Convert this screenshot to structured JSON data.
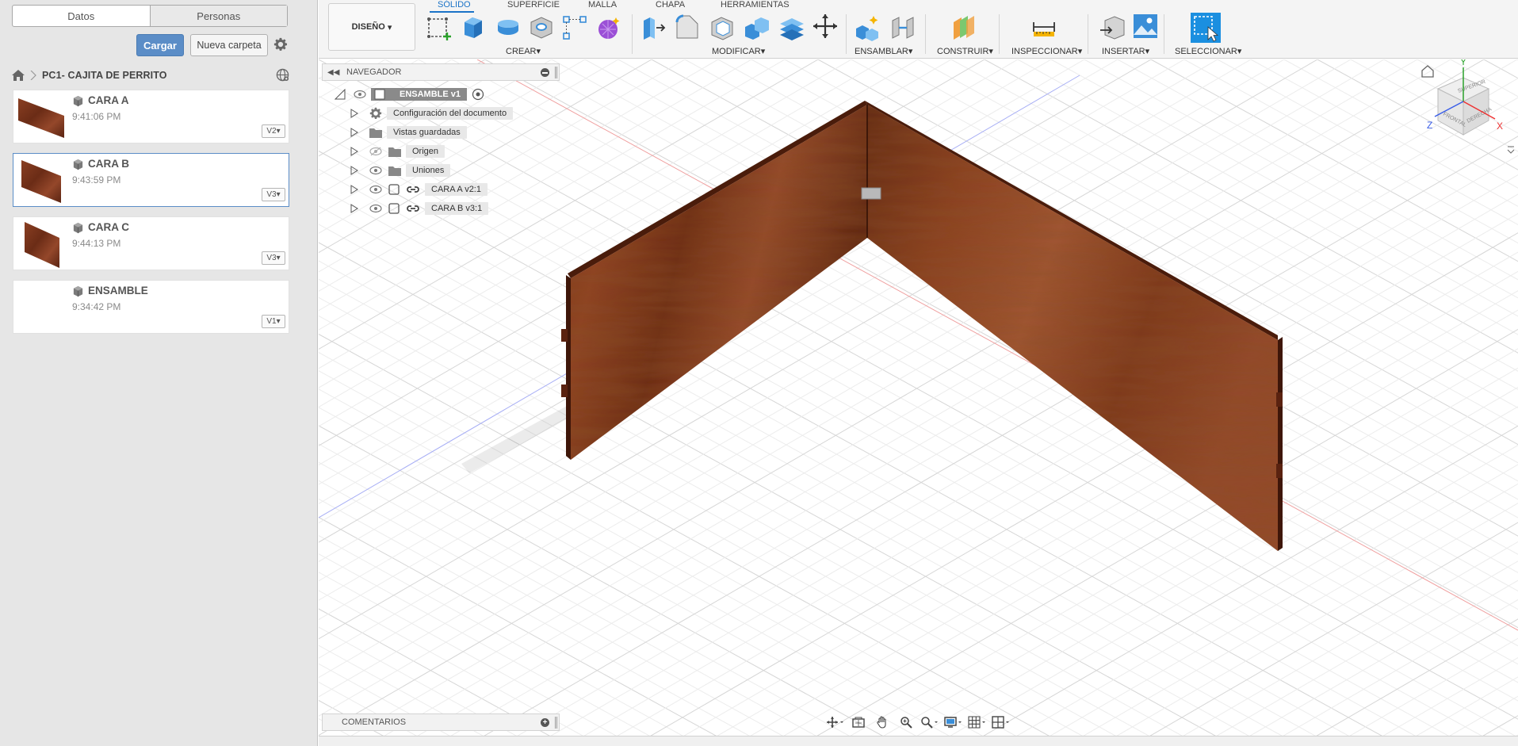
{
  "data_panel": {
    "tabs": [
      {
        "label": "Datos",
        "active": true
      },
      {
        "label": "Personas",
        "active": false
      }
    ],
    "upload_label": "Cargar",
    "new_folder_label": "Nueva carpeta",
    "breadcrumb_title": "PC1- CAJITA DE PERRITO",
    "files": [
      {
        "name": "CARA A",
        "time": "9:41:06 PM",
        "version": "V2",
        "selected": false,
        "has_thumb": true
      },
      {
        "name": "CARA B",
        "time": "9:43:59 PM",
        "version": "V3",
        "selected": true,
        "has_thumb": true
      },
      {
        "name": "CARA C",
        "time": "9:44:13 PM",
        "version": "V3",
        "selected": false,
        "has_thumb": true
      },
      {
        "name": "ENSAMBLE",
        "time": "9:34:42 PM",
        "version": "V1",
        "selected": false,
        "has_thumb": false
      }
    ]
  },
  "toolbar": {
    "workspace_label": "DISEÑO",
    "tabs": [
      "SÓLIDO",
      "SUPERFICIE",
      "MALLA",
      "CHAPA",
      "HERRAMIENTAS"
    ],
    "active_tab": "SÓLIDO",
    "groups": {
      "create": "CREAR",
      "modify": "MODIFICAR",
      "assemble": "ENSAMBLAR",
      "construct": "CONSTRUIR",
      "inspect": "INSPECCIONAR",
      "insert": "INSERTAR",
      "select": "SELECCIONAR"
    },
    "accent_color": "#1b73c7"
  },
  "navigator": {
    "title": "NAVEGADOR",
    "root": "ENSAMBLE v1",
    "items": [
      {
        "label": "Configuración del documento",
        "icon": "gear-icon"
      },
      {
        "label": "Vistas guardadas",
        "icon": "folder-icon"
      },
      {
        "label": "Origen",
        "icon": "folder-icon",
        "hidden": true
      },
      {
        "label": "Uniones",
        "icon": "folder-icon"
      },
      {
        "label": "CARA A v2:1",
        "icon": "component-icon"
      },
      {
        "label": "CARA B v3:1",
        "icon": "component-icon"
      }
    ]
  },
  "comments": {
    "title": "COMENTARIOS"
  },
  "viewcube": {
    "faces": {
      "top": "SUPERIOR",
      "front": "FRONTAL",
      "right": "DERECHA"
    },
    "axes": {
      "x": "X",
      "y": "Y",
      "z": "Z"
    }
  }
}
